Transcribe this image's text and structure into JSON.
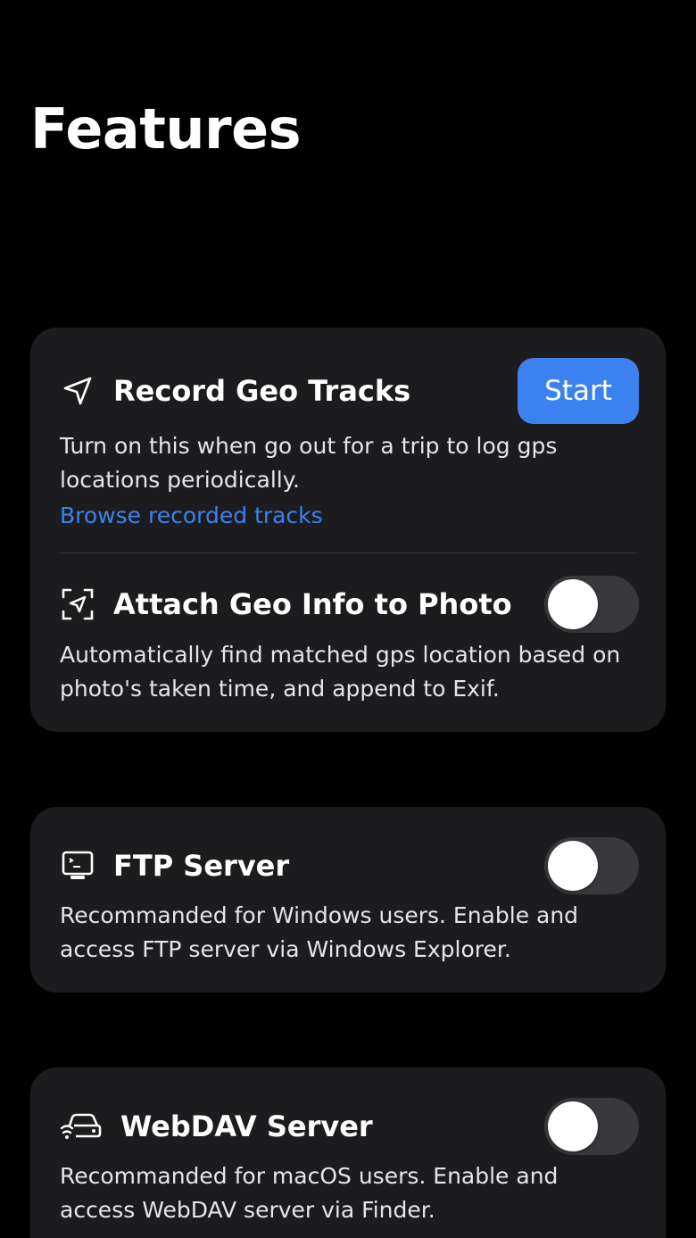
{
  "page": {
    "title": "Features"
  },
  "colors": {
    "background": "#000000",
    "card": "#1c1c1e",
    "accent": "#3b82f0",
    "toggle_off": "#39393d"
  },
  "record_geo": {
    "icon": "location-arrow-icon",
    "title": "Record Geo Tracks",
    "button_label": "Start",
    "description": "Turn on this when go out for a trip to log gps locations periodically.",
    "link": "Browse recorded tracks"
  },
  "attach_geo": {
    "icon": "photo-location-icon",
    "title": "Attach Geo Info to Photo",
    "enabled": false,
    "description": "Automatically find matched gps location based on photo's taken time, and append to Exif."
  },
  "ftp": {
    "icon": "computer-terminal-icon",
    "title": "FTP Server",
    "enabled": false,
    "description": "Recommanded for Windows users. Enable and access FTP server via Windows Explorer."
  },
  "webdav": {
    "icon": "network-drive-icon",
    "title": "WebDAV Server",
    "enabled": false,
    "description": "Recommanded for macOS users. Enable and access WebDAV server via Finder."
  }
}
